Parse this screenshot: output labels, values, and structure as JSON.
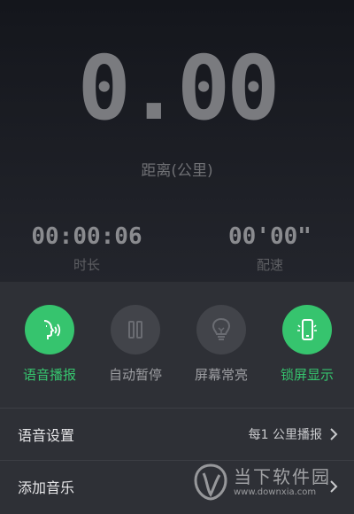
{
  "run": {
    "distance_value": "0.00",
    "distance_label": "距离(公里)",
    "duration_value": "00:00:06",
    "duration_label": "时长",
    "pace_value": "00'00\"",
    "pace_label": "配速"
  },
  "controls": [
    {
      "label": "语音播报",
      "icon": "voice-broadcast-icon",
      "active": true
    },
    {
      "label": "自动暂停",
      "icon": "pause-icon",
      "active": false
    },
    {
      "label": "屏幕常亮",
      "icon": "lightbulb-icon",
      "active": false
    },
    {
      "label": "锁屏显示",
      "icon": "phone-lock-icon",
      "active": true
    }
  ],
  "settings": {
    "voice_settings_label": "语音设置",
    "voice_settings_value": "每1 公里播报",
    "add_music_label": "添加音乐"
  },
  "watermark": {
    "name": "当下软件园",
    "url": "www.downxia.com"
  },
  "colors": {
    "accent": "#36c46e",
    "panel": "#2e3036",
    "background": "#1a1b21"
  }
}
